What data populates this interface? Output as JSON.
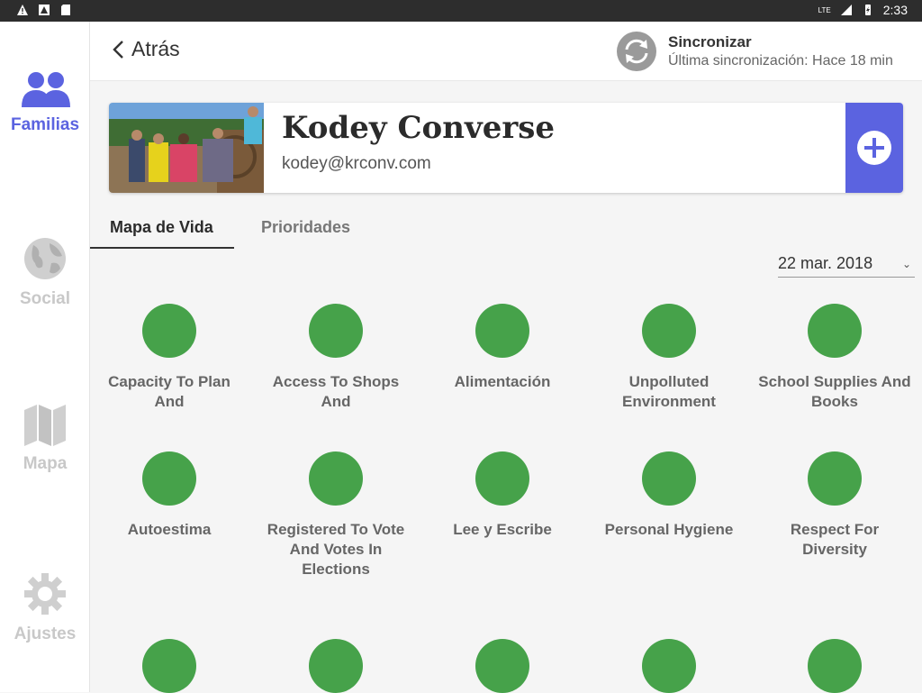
{
  "status_bar": {
    "time": "2:33",
    "network": "LTE"
  },
  "sidebar": {
    "items": [
      {
        "label": "Familias",
        "icon": "people-icon",
        "active": true
      },
      {
        "label": "Social",
        "icon": "globe-icon",
        "active": false
      },
      {
        "label": "Mapa",
        "icon": "map-icon",
        "active": false
      },
      {
        "label": "Ajustes",
        "icon": "gear-icon",
        "active": false
      }
    ]
  },
  "topbar": {
    "back_label": "Atrás",
    "sync_title": "Sincronizar",
    "sync_subtitle": "Última sincronización: Hace 18 min"
  },
  "family_card": {
    "name": "Kodey Converse",
    "email": "kodey@krconv.com"
  },
  "tabs": [
    {
      "label": "Mapa de Vida",
      "active": true
    },
    {
      "label": "Prioridades",
      "active": false
    }
  ],
  "date_select": {
    "value": "22 mar. 2018"
  },
  "indicators": [
    {
      "label": "Capacity To Plan And",
      "color": "#46a24a"
    },
    {
      "label": "Access To Shops And",
      "color": "#46a24a"
    },
    {
      "label": "Alimentación",
      "color": "#46a24a"
    },
    {
      "label": "Unpolluted Environment",
      "color": "#46a24a"
    },
    {
      "label": "School Supplies And Books",
      "color": "#46a24a"
    },
    {
      "label": "Autoestima",
      "color": "#46a24a"
    },
    {
      "label": "Registered To Vote And Votes In Elections",
      "color": "#46a24a"
    },
    {
      "label": "Lee y Escribe",
      "color": "#46a24a"
    },
    {
      "label": "Personal Hygiene",
      "color": "#46a24a"
    },
    {
      "label": "Respect For Diversity",
      "color": "#46a24a"
    },
    {
      "label": "",
      "color": "#46a24a"
    },
    {
      "label": "",
      "color": "#46a24a"
    },
    {
      "label": "",
      "color": "#46a24a"
    },
    {
      "label": "",
      "color": "#46a24a"
    },
    {
      "label": "",
      "color": "#46a24a"
    }
  ],
  "colors": {
    "accent": "#5b63e0",
    "green": "#46a24a"
  }
}
